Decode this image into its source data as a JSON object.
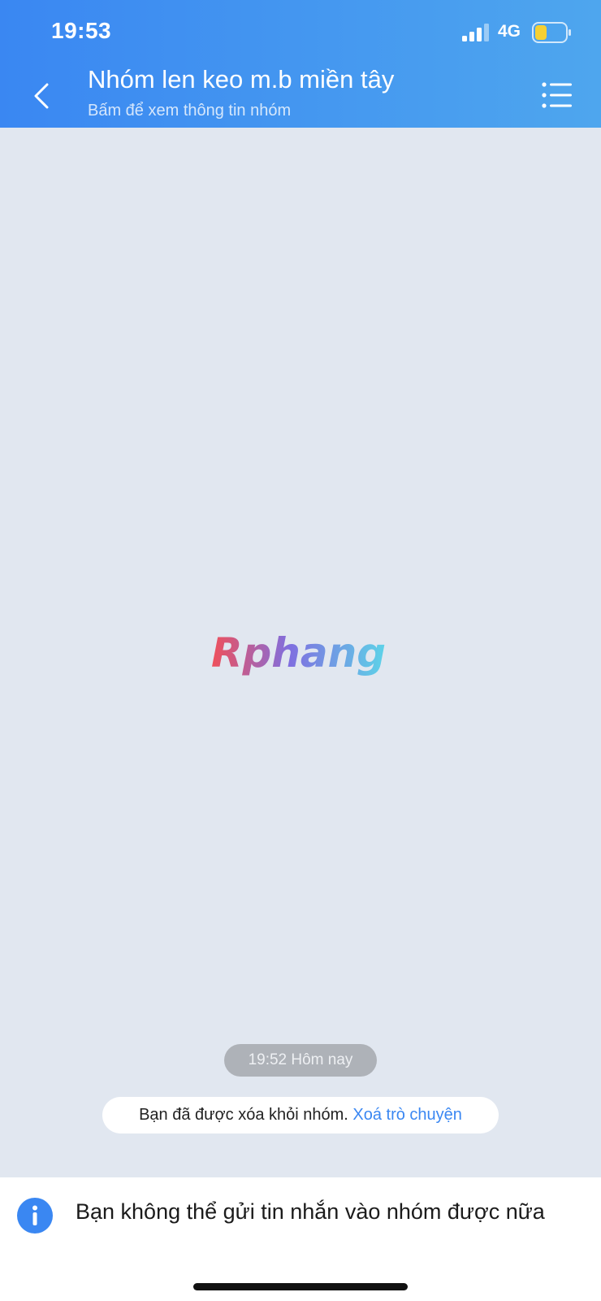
{
  "status_bar": {
    "time": "19:53",
    "network": "4G",
    "icons": [
      "signal-icon",
      "battery-icon"
    ]
  },
  "header": {
    "title": "Nhóm len keo m.b miền tây",
    "subtitle": "Bấm để xem thông tin nhóm",
    "back_icon": "chevron-left-icon",
    "menu_icon": "list-icon"
  },
  "watermark": {
    "text": "Rphang"
  },
  "chat": {
    "timestamp": "19:52 Hôm nay",
    "notice_text": "Bạn đã được xóa khỏi nhóm.",
    "notice_action": "Xoá trò chuyện"
  },
  "footer": {
    "message": "Bạn không thể gửi tin nhắn vào nhóm được nữa",
    "icon": "info-icon"
  },
  "colors": {
    "header_start": "#3a87f2",
    "header_end": "#4ea6ee",
    "background": "#e1e7f0",
    "link": "#3a87f2",
    "battery_level": "#f5d033"
  }
}
